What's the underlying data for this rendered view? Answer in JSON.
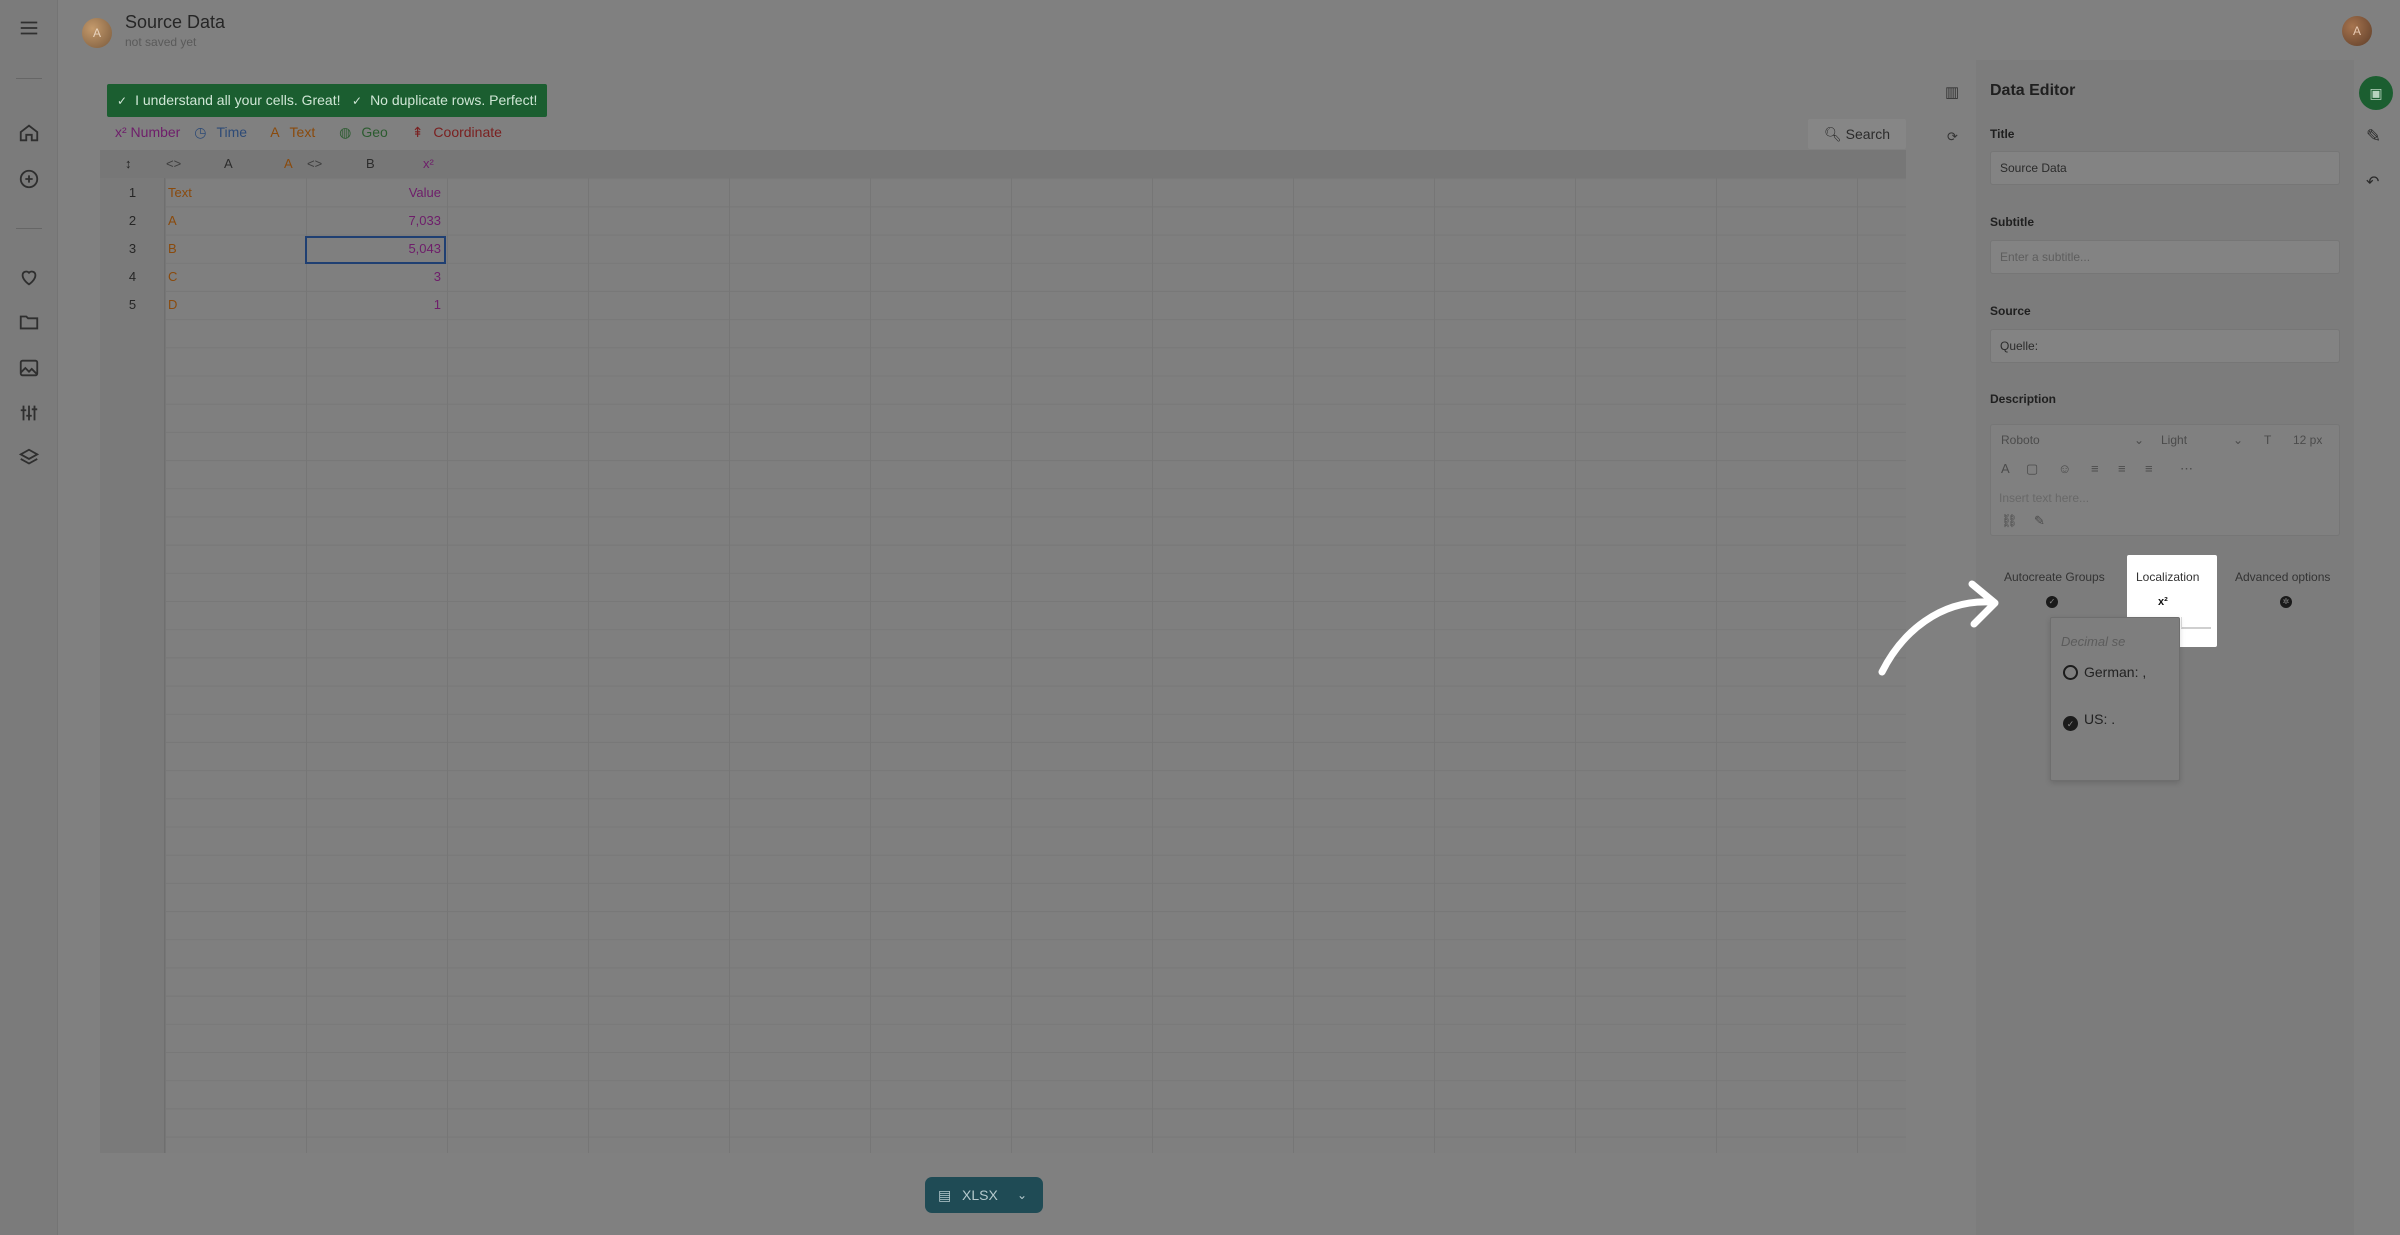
{
  "header": {
    "avatar_initial": "A",
    "title": "Source Data",
    "subtitle": "not saved yet",
    "user_initial": "A"
  },
  "nav": {
    "icons": [
      "menu-icon",
      "home-icon",
      "add-circle-icon",
      "heart-icon",
      "folder-icon",
      "image-icon",
      "sliders-icon",
      "layers-icon"
    ]
  },
  "banners": [
    {
      "text": "I understand all your cells. Great!"
    },
    {
      "text": "No duplicate rows. Perfect!"
    }
  ],
  "types": {
    "number": "x² Number",
    "time": "Time",
    "text": "Text",
    "geo": "Geo",
    "coordinate": "Coordinate"
  },
  "search": {
    "label": "Search"
  },
  "sheet": {
    "col_letters": [
      "A",
      "B"
    ],
    "col_b_type": "x²",
    "rows": [
      {
        "n": "1",
        "a": "Text",
        "b": "Value"
      },
      {
        "n": "2",
        "a": "A",
        "b": "7,033"
      },
      {
        "n": "3",
        "a": "B",
        "b": "5,043"
      },
      {
        "n": "4",
        "a": "C",
        "b": "3"
      },
      {
        "n": "5",
        "a": "D",
        "b": "1"
      }
    ],
    "selected_cell": "B3"
  },
  "export": {
    "label": "XLSX"
  },
  "editor": {
    "title": "Data Editor",
    "fields": {
      "title_label": "Title",
      "title_value": "Source Data",
      "subtitle_label": "Subtitle",
      "subtitle_placeholder": "Enter a subtitle...",
      "source_label": "Source",
      "source_value": "Quelle:",
      "description_label": "Description",
      "font": "Roboto",
      "weight": "Light",
      "size": "12 px",
      "description_placeholder": "Insert text here..."
    },
    "options": {
      "autocreate": "Autocreate Groups",
      "localization": "Localization",
      "localization_icon": "x²",
      "advanced": "Advanced options"
    },
    "decimal": {
      "header": "Decimal se",
      "options": [
        {
          "label": "German: ,",
          "selected": false
        },
        {
          "label": "US: .",
          "selected": true
        }
      ]
    }
  },
  "colors": {
    "success": "#1b5e30",
    "accent_teal": "#1f4b55",
    "highlight": "#ffffff"
  }
}
